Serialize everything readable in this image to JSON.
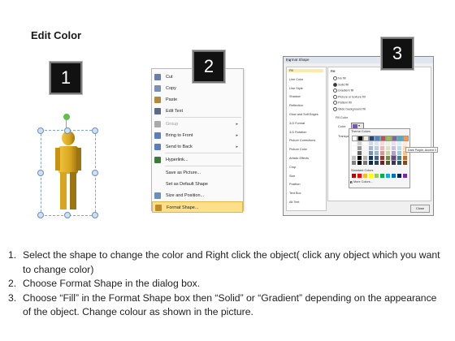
{
  "title": "Edit Color",
  "badges": [
    "1",
    "2",
    "3"
  ],
  "context_menu": {
    "items": [
      {
        "label": "Cut",
        "icon": "scissors-icon",
        "disabled": false,
        "arrow": false,
        "highlight": false
      },
      {
        "label": "Copy",
        "icon": "copy-icon",
        "disabled": false,
        "arrow": false,
        "highlight": false
      },
      {
        "label": "Paste",
        "icon": "paste-icon",
        "disabled": false,
        "arrow": false,
        "highlight": false
      },
      {
        "label": "Edit Text",
        "icon": "edit-text-icon",
        "disabled": false,
        "arrow": false,
        "highlight": false
      },
      {
        "label": "Group",
        "icon": "group-icon",
        "disabled": true,
        "arrow": true,
        "highlight": false
      },
      {
        "label": "Bring to Front",
        "icon": "bring-front-icon",
        "disabled": false,
        "arrow": true,
        "highlight": false
      },
      {
        "label": "Send to Back",
        "icon": "send-back-icon",
        "disabled": false,
        "arrow": true,
        "highlight": false
      },
      {
        "label": "Hyperlink...",
        "icon": "hyperlink-icon",
        "disabled": false,
        "arrow": false,
        "highlight": false
      },
      {
        "label": "Save as Picture...",
        "icon": "",
        "disabled": false,
        "arrow": false,
        "highlight": false
      },
      {
        "label": "Set as Default Shape",
        "icon": "",
        "disabled": false,
        "arrow": false,
        "highlight": false
      },
      {
        "label": "Size and Position...",
        "icon": "size-position-icon",
        "disabled": false,
        "arrow": false,
        "highlight": false
      },
      {
        "label": "Format Shape...",
        "icon": "format-shape-icon",
        "disabled": false,
        "arrow": false,
        "highlight": true
      }
    ]
  },
  "dialog": {
    "title": "Format Shape",
    "title_buttons": "? X",
    "nav": [
      "Fill",
      "Line Color",
      "Line Style",
      "Shadow",
      "Reflection",
      "Glow and Soft Edges",
      "3-D Format",
      "3-D Rotation",
      "Picture Corrections",
      "Picture Color",
      "Artistic Effects",
      "Crop",
      "Size",
      "Position",
      "Text Box",
      "Alt Text"
    ],
    "fill_heading": "Fill",
    "options": [
      {
        "label": "No fill",
        "on": false
      },
      {
        "label": "Solid fill",
        "on": true
      },
      {
        "label": "Gradient fill",
        "on": false
      },
      {
        "label": "Picture or texture fill",
        "on": false
      },
      {
        "label": "Pattern fill",
        "on": false
      },
      {
        "label": "Slide background fill",
        "on": false
      }
    ],
    "fill_color_heading": "Fill Color",
    "color_label": "Color:",
    "transparency_label": "Transpa",
    "theme_colors_label": "Theme Colors",
    "standard_colors_label": "Standard Colors",
    "more_colors_label": "More Colors...",
    "tooltip": "Dark Purple, Accent 3",
    "close_label": "Close",
    "theme_top_row": [
      "#ffffff",
      "#000000",
      "#eeece1",
      "#1f497d",
      "#4f81bd",
      "#c0504d",
      "#9bbb59",
      "#8064a2",
      "#4bacc6",
      "#f79646"
    ],
    "standard_row": [
      "#c00000",
      "#ff0000",
      "#ffc000",
      "#ffff00",
      "#92d050",
      "#00b050",
      "#00b0f0",
      "#0070c0",
      "#002060",
      "#7030a0"
    ]
  },
  "instructions": [
    {
      "num": "1.",
      "text": "Select the shape to change the color and Right click the object( click any object which you want to change color)"
    },
    {
      "num": "2.",
      "text": "Choose Format Shape in the dialog box."
    },
    {
      "num": "3.",
      "text": "Choose “Fill” in the Format Shape box then “Solid” or “Gradient” depending on the appearance of the object. Change colour as shown in the picture."
    }
  ],
  "colors": {
    "figure": "#d9a520",
    "figure_dark": "#9c7410",
    "handle": "#7fb3e8",
    "rotate_handle": "#5fbf4a",
    "menu_highlight": "#ffe08a"
  }
}
